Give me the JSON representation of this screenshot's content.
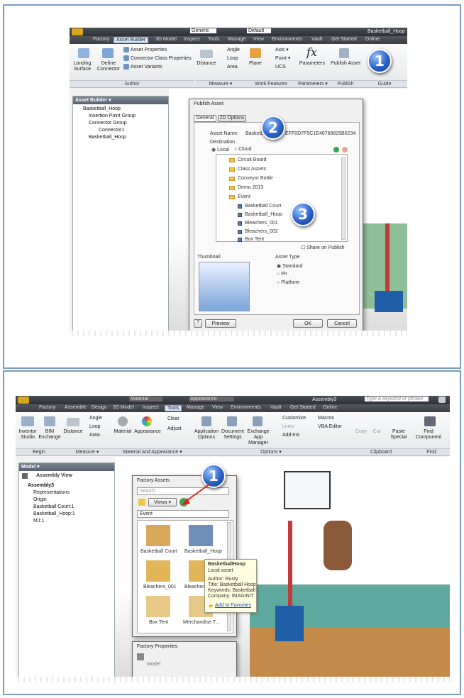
{
  "top": {
    "title_bar": {
      "preset1": "Generic",
      "preset2": "Default",
      "doc_title": "Basketball_Hoop"
    },
    "menu_tabs": [
      "Factory",
      "Asset Builder",
      "3D Model",
      "Inspect",
      "Tools",
      "Manage",
      "View",
      "Environments",
      "Vault",
      "Get Started",
      "Online"
    ],
    "ribbon": {
      "author": {
        "landing_surface": "Landing Surface",
        "define_connector": "Define Connector",
        "asset_properties": "Asset Properties",
        "connector_class_properties": "Connector Class Properties",
        "asset_variants": "Asset Variants",
        "label": "Author"
      },
      "measure": {
        "distance": "Distance",
        "angle": "Angle",
        "loop": "Loop",
        "area": "Area",
        "label": "Measure ▾"
      },
      "work_features": {
        "plane": "Plane",
        "axis": "Axis ▾",
        "point": "Point ▾",
        "ucs": "UCS",
        "label": "Work Features"
      },
      "parameters": {
        "parameters": "Parameters",
        "label": "Parameters ▾"
      },
      "publish": {
        "publish_asset": "Publish Asset",
        "label": "Publish"
      },
      "guide": {
        "label": "Guide"
      }
    },
    "browser": {
      "title": "Asset Builder ▾",
      "items": [
        "Basketball_Hoop",
        "Insertion Point Group",
        "Connector Group",
        "Connector1",
        "Basketball_Hoop"
      ]
    },
    "dialog": {
      "title": "Publish Asset",
      "tabs": [
        "General",
        "2D Options"
      ],
      "asset_name_label": "Asset Name:",
      "asset_name_value": "Basketb",
      "asset_id": "EFF0D7F5C1E40769825B0234",
      "destination_label": "Destination",
      "local": "Local",
      "cloud": "Cloud",
      "folders": [
        "Circuit Board",
        "Class Assets",
        "Conveyor Bottle",
        "Demo 2013",
        "Event"
      ],
      "event_items": [
        "Basketball Court",
        "Basketball_Hoop",
        "Bleachers_001",
        "Bleachers_002",
        "Box Tent"
      ],
      "share": "Share on Publish",
      "thumbnail_label": "Thumbnail",
      "asset_type_label": "Asset Type",
      "asset_types": [
        "Standard",
        "Pit",
        "Platform"
      ],
      "preview": "Preview",
      "ok": "OK",
      "cancel": "Cancel"
    },
    "badges": [
      "1",
      "2",
      "3"
    ]
  },
  "bottom": {
    "title_bar": {
      "preset1": "Material",
      "preset2": "Appearance",
      "doc_title": "Assembly3",
      "search_placeholder": "Type a keyword or phrase"
    },
    "menu_tabs": [
      "Factory",
      "Assemble",
      "Design",
      "3D Model",
      "Inspect",
      "Tools",
      "Manage",
      "View",
      "Environments",
      "Vault",
      "Get Started",
      "Online"
    ],
    "ribbon": {
      "begin": {
        "inventor_studio": "Inventor Studio",
        "bim_exchange": "BIM Exchange",
        "label": "Begin"
      },
      "measure": {
        "distance": "Distance",
        "angle": "Angle",
        "loop": "Loop",
        "area": "Area",
        "label": "Measure ▾"
      },
      "material": {
        "material": "Material",
        "appearance": "Appearance",
        "clear": "Clear",
        "adjust": "Adjust",
        "label": "Material and Appearance ▾"
      },
      "options": {
        "application_options": "Application Options",
        "document_settings": "Document Settings",
        "exchange_app_manager": "Exchange App Manager",
        "customize": "Customize",
        "links": "Links",
        "add_ins": "Add-Ins",
        "macros": "Macros",
        "vba_editor": "VBA Editor",
        "label": "Options ▾"
      },
      "clipboard": {
        "copy": "Copy",
        "cut": "Cut",
        "paste_special": "Paste Special",
        "label": "Clipboard"
      },
      "find": {
        "find_component": "Find Component",
        "label": "Find"
      }
    },
    "browser": {
      "title": "Model ▾",
      "view": "Assembly View",
      "items": [
        "Assembly3",
        "Representations",
        "Origin",
        "Basketball Court:1",
        "Basketball_Hoop:1",
        "MJ:1"
      ]
    },
    "factory_assets": {
      "title": "Factory Assets",
      "search_placeholder": "Search",
      "views": "Views ▾",
      "category": "Event",
      "items": [
        "Basketball Court",
        "Basketball_Hoop",
        "Bleachers_001",
        "Bleachers_",
        "Box Tent",
        "Merchandise T..."
      ]
    },
    "tooltip": {
      "name": "BasketballHoop",
      "subtitle": "Local asset",
      "author": "Author:  Rusty",
      "title": "Title:  Basketball Hoop",
      "keywords": "Keywords:  Basketball",
      "company": "Company:  IMAGINiT",
      "favorites": "Add to Favorites"
    },
    "factory_properties": {
      "title": "Factory Properties",
      "model": "Model"
    },
    "badge": "1"
  },
  "colors": {
    "frame_border": "#7a9bc4",
    "badge_blue": "#2a62c9",
    "ribbon_dark": "#3a3d42"
  }
}
